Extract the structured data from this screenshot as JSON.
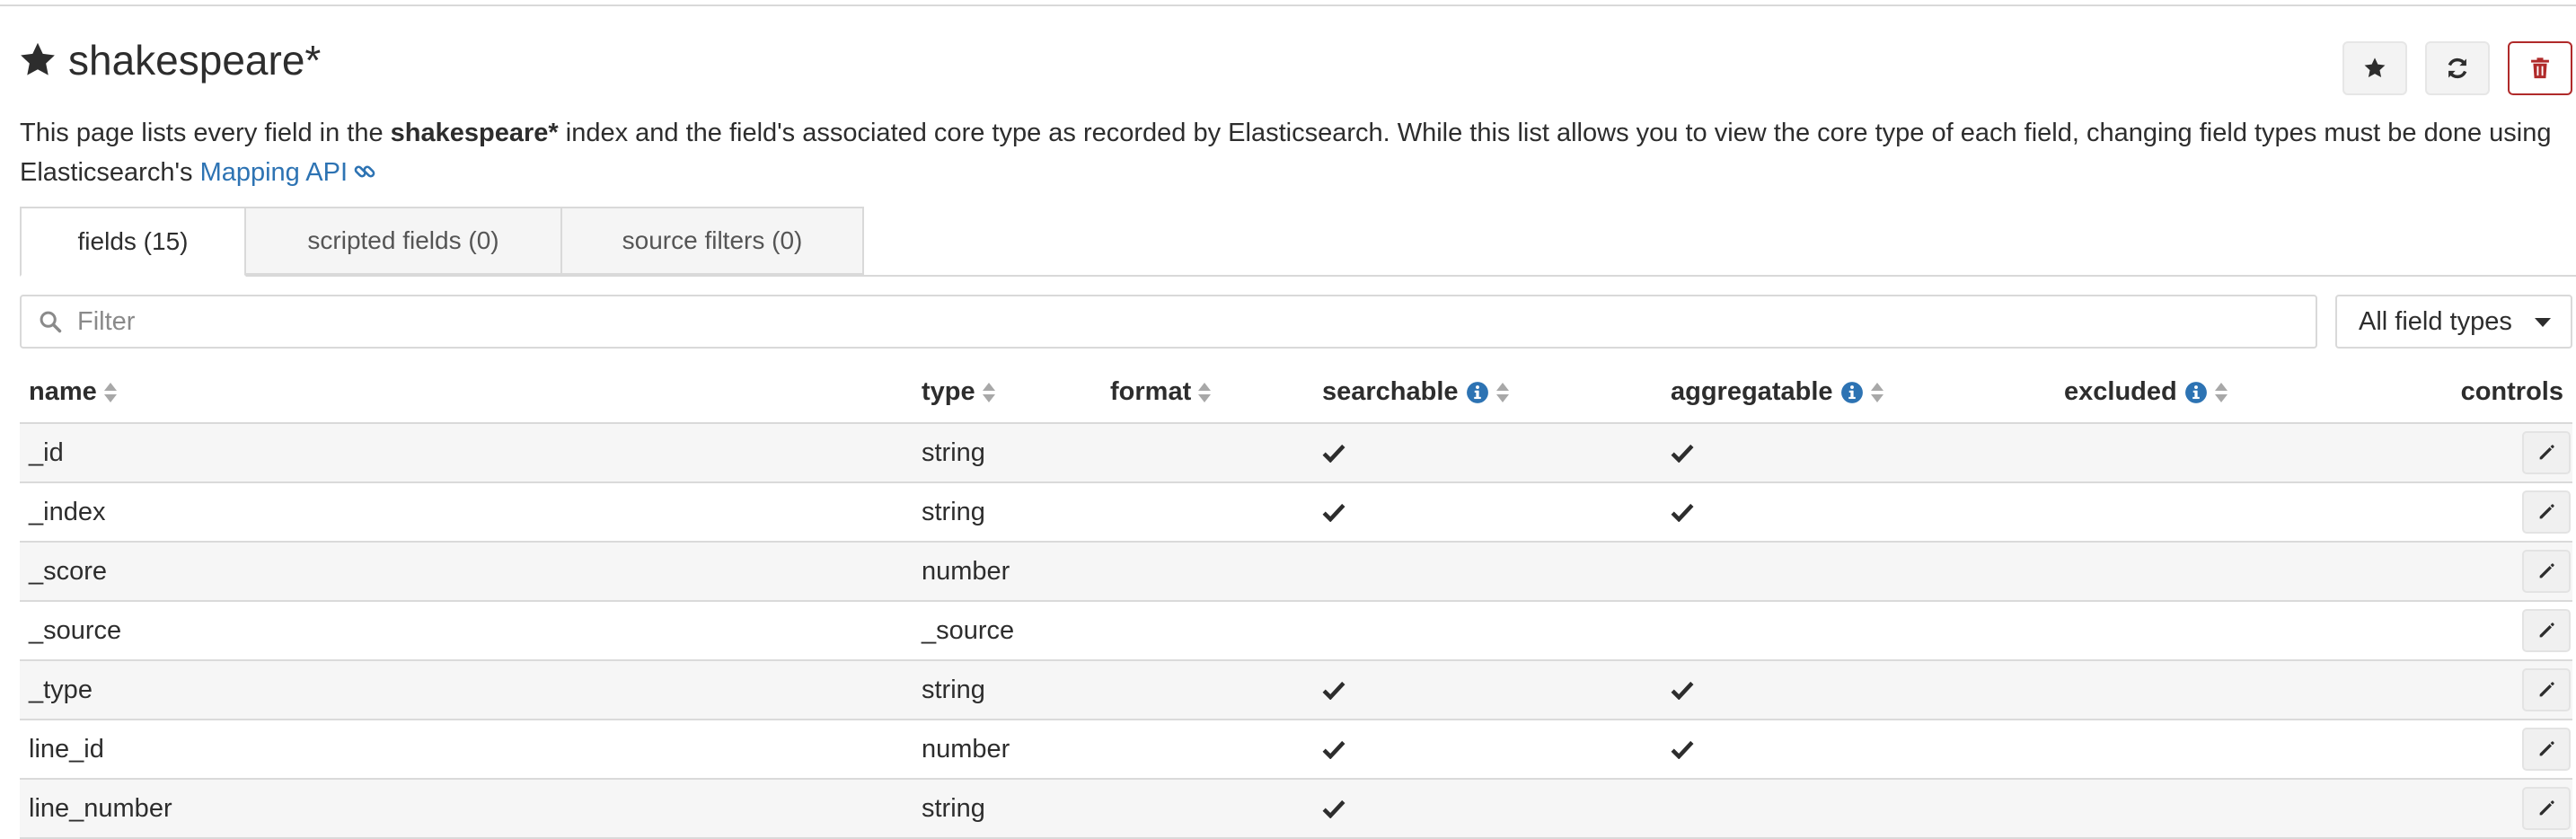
{
  "header": {
    "title": "shakespeare*",
    "actions": {
      "favorite": "star-icon",
      "refresh": "refresh-icon",
      "delete": "trash-icon"
    }
  },
  "description": {
    "before": "This page lists every field in the ",
    "index_name": "shakespeare*",
    "after": " index and the field's associated core type as recorded by Elasticsearch. While this list allows you to view the core type of each field, changing field types must be done using Elasticsearch's ",
    "link_text": "Mapping API"
  },
  "tabs": [
    {
      "label": "fields (15)",
      "active": true
    },
    {
      "label": "scripted fields (0)",
      "active": false
    },
    {
      "label": "source filters (0)",
      "active": false
    }
  ],
  "filter": {
    "placeholder": "Filter",
    "value": ""
  },
  "type_select": {
    "selected": "All field types"
  },
  "table": {
    "columns": {
      "name": "name",
      "type": "type",
      "format": "format",
      "searchable": "searchable",
      "aggregatable": "aggregatable",
      "excluded": "excluded",
      "controls": "controls"
    },
    "rows": [
      {
        "name": "_id",
        "type": "string",
        "format": "",
        "searchable": true,
        "aggregatable": true,
        "excluded": false
      },
      {
        "name": "_index",
        "type": "string",
        "format": "",
        "searchable": true,
        "aggregatable": true,
        "excluded": false
      },
      {
        "name": "_score",
        "type": "number",
        "format": "",
        "searchable": false,
        "aggregatable": false,
        "excluded": false
      },
      {
        "name": "_source",
        "type": "_source",
        "format": "",
        "searchable": false,
        "aggregatable": false,
        "excluded": false
      },
      {
        "name": "_type",
        "type": "string",
        "format": "",
        "searchable": true,
        "aggregatable": true,
        "excluded": false
      },
      {
        "name": "line_id",
        "type": "number",
        "format": "",
        "searchable": true,
        "aggregatable": true,
        "excluded": false
      },
      {
        "name": "line_number",
        "type": "string",
        "format": "",
        "searchable": true,
        "aggregatable": false,
        "excluded": false
      }
    ]
  },
  "colors": {
    "link": "#2d73b3",
    "info_icon": "#2d73b3",
    "danger": "#b02a2a",
    "text": "#2d2d2d"
  }
}
